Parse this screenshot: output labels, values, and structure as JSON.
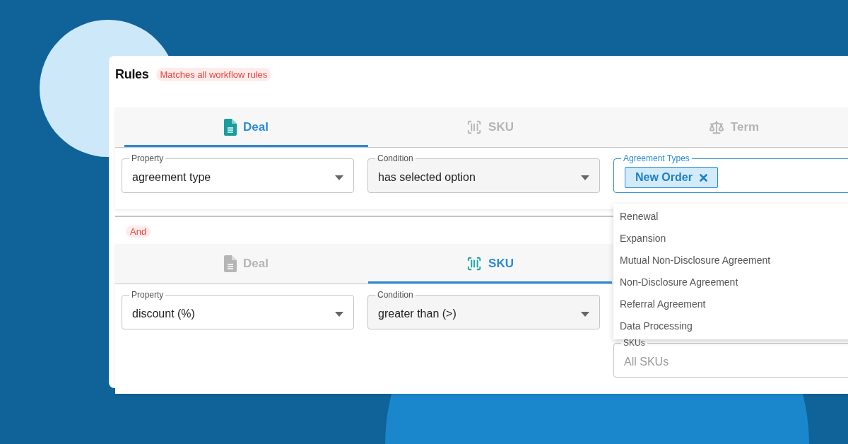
{
  "header": {
    "title": "Rules",
    "badge": "Matches all workflow rules"
  },
  "rule_groups": [
    {
      "tabs": [
        {
          "label": "Deal",
          "kind": "document",
          "selected": true
        },
        {
          "label": "SKU",
          "kind": "barcode",
          "selected": false
        },
        {
          "label": "Term",
          "kind": "scale",
          "selected": false
        }
      ],
      "fields": [
        {
          "kind": "select",
          "label": "Property",
          "value": "agreement type"
        },
        {
          "kind": "select",
          "label": "Condition",
          "value": "has selected option"
        },
        {
          "kind": "chips",
          "label": "Agreement Types",
          "chips": [
            "New Order"
          ],
          "options": [
            "Renewal",
            "Expansion",
            "Mutual Non-Disclosure Agreement",
            "Non-Disclosure Agreement",
            "Referral Agreement",
            "Data Processing"
          ]
        }
      ]
    },
    {
      "connector": "And",
      "tabs": [
        {
          "label": "Deal",
          "kind": "document",
          "selected": false
        },
        {
          "label": "SKU",
          "kind": "barcode",
          "selected": true
        }
      ],
      "fields": [
        {
          "kind": "select",
          "label": "Property",
          "value": "discount (%)"
        },
        {
          "kind": "select",
          "label": "Condition",
          "value": "greater than (>)"
        },
        {
          "kind": "text",
          "label": "SKUs",
          "placeholder": "All SKUs"
        }
      ]
    }
  ]
}
